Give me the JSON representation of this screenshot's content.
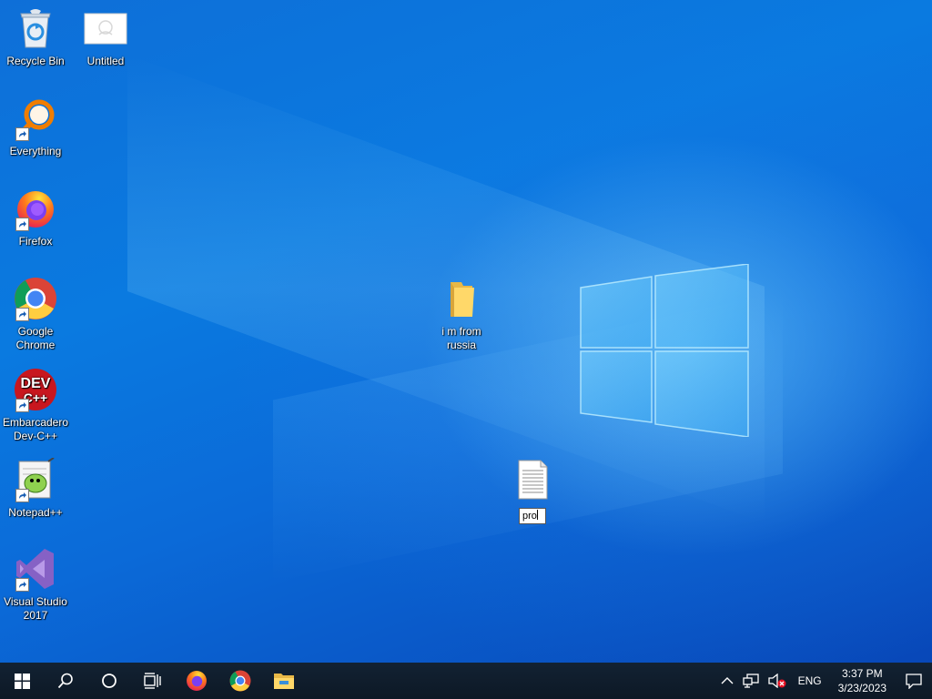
{
  "desktop": {
    "icons": [
      {
        "label": "Recycle Bin"
      },
      {
        "label": "Untitled"
      },
      {
        "label": "Everything"
      },
      {
        "label": "Firefox"
      },
      {
        "label": "Google Chrome"
      },
      {
        "label": "Embarcadero Dev-C++"
      },
      {
        "label": "Notepad++"
      },
      {
        "label": "Visual Studio 2017"
      },
      {
        "label": "i m from russia"
      },
      {
        "rename_value": "pro"
      }
    ],
    "devcpp_icon_text_1": "DEV",
    "devcpp_icon_text_2": "C++"
  },
  "taskbar": {
    "language": "ENG",
    "time": "3:37 PM",
    "date": "3/23/2023"
  },
  "colors": {
    "taskbar_bg": "#0f1c2b",
    "accent": "#0a7ae0"
  },
  "icons": [
    "recycle-bin-icon",
    "untitled-image-icon",
    "everything-icon",
    "firefox-icon",
    "chrome-icon",
    "devcpp-icon",
    "notepadpp-icon",
    "visual-studio-icon",
    "folder-icon",
    "text-file-icon",
    "start-icon",
    "search-icon",
    "cortana-icon",
    "task-view-icon",
    "file-explorer-icon",
    "chevron-up-icon",
    "network-icon",
    "volume-muted-icon",
    "notification-icon"
  ]
}
